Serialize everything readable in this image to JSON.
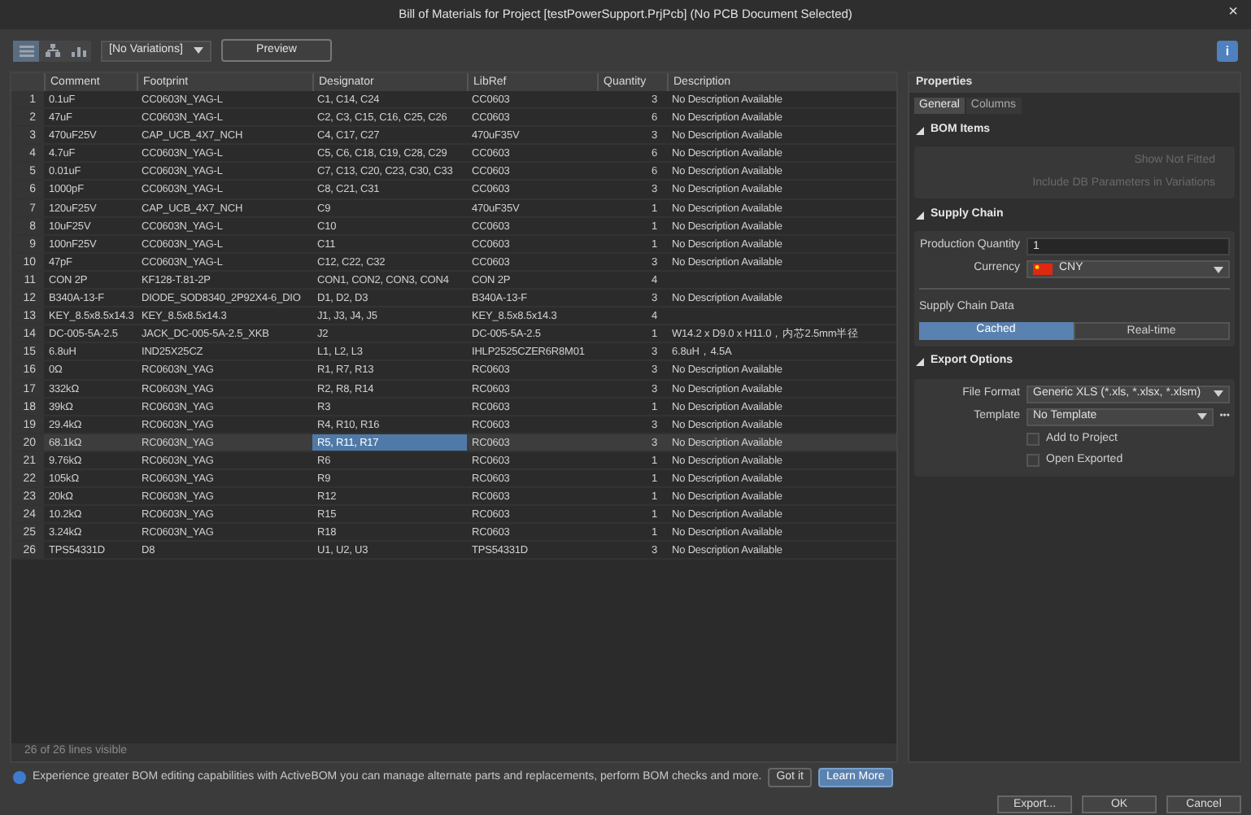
{
  "window": {
    "title": "Bill of Materials for Project [testPowerSupport.PrjPcb] (No PCB Document Selected)",
    "close": "×"
  },
  "toolbar": {
    "views": [
      {
        "kind": "table",
        "selected": true
      },
      {
        "kind": "tree",
        "selected": false
      },
      {
        "kind": "chart",
        "selected": false
      }
    ],
    "variations": "[No Variations]",
    "preview": "Preview",
    "info": "i"
  },
  "table": {
    "columns": [
      "Comment",
      "Footprint",
      "Designator",
      "LibRef",
      "Quantity",
      "Description"
    ],
    "rows": [
      {
        "no": "1",
        "comment": "0.1uF",
        "footprint": "CC0603N_YAG-L",
        "designator": "C1, C14, C24",
        "libref": "CC0603",
        "quantity": "3",
        "description": "No Description Available",
        "selected": false
      },
      {
        "no": "2",
        "comment": "47uF",
        "footprint": "CC0603N_YAG-L",
        "designator": "C2, C3, C15, C16, C25, C26",
        "libref": "CC0603",
        "quantity": "6",
        "description": "No Description Available",
        "selected": false
      },
      {
        "no": "3",
        "comment": "470uF25V",
        "footprint": "CAP_UCB_4X7_NCH",
        "designator": "C4, C17, C27",
        "libref": "470uF35V",
        "quantity": "3",
        "description": "No Description Available",
        "selected": false
      },
      {
        "no": "4",
        "comment": "4.7uF",
        "footprint": "CC0603N_YAG-L",
        "designator": "C5, C6, C18, C19, C28, C29",
        "libref": "CC0603",
        "quantity": "6",
        "description": "No Description Available",
        "selected": false
      },
      {
        "no": "5",
        "comment": "0.01uF",
        "footprint": "CC0603N_YAG-L",
        "designator": "C7, C13, C20, C23, C30, C33",
        "libref": "CC0603",
        "quantity": "6",
        "description": "No Description Available",
        "selected": false
      },
      {
        "no": "6",
        "comment": "1000pF",
        "footprint": "CC0603N_YAG-L",
        "designator": "C8, C21, C31",
        "libref": "CC0603",
        "quantity": "3",
        "description": "No Description Available",
        "selected": false
      },
      {
        "no": "7",
        "comment": "120uF25V",
        "footprint": "CAP_UCB_4X7_NCH",
        "designator": "C9",
        "libref": "470uF35V",
        "quantity": "1",
        "description": "No Description Available",
        "selected": false
      },
      {
        "no": "8",
        "comment": "10uF25V",
        "footprint": "CC0603N_YAG-L",
        "designator": "C10",
        "libref": "CC0603",
        "quantity": "1",
        "description": "No Description Available",
        "selected": false
      },
      {
        "no": "9",
        "comment": "100nF25V",
        "footprint": "CC0603N_YAG-L",
        "designator": "C11",
        "libref": "CC0603",
        "quantity": "1",
        "description": "No Description Available",
        "selected": false
      },
      {
        "no": "10",
        "comment": "47pF",
        "footprint": "CC0603N_YAG-L",
        "designator": "C12, C22, C32",
        "libref": "CC0603",
        "quantity": "3",
        "description": "No Description Available",
        "selected": false
      },
      {
        "no": "11",
        "comment": "CON 2P",
        "footprint": "KF128-T.81-2P",
        "designator": "CON1, CON2, CON3, CON4",
        "libref": "CON 2P",
        "quantity": "4",
        "selected": false
      },
      {
        "no": "12",
        "comment": "B340A-13-F",
        "footprint": "DIODE_SOD8340_2P92X4-6_DIO",
        "designator": "D1, D2, D3",
        "libref": "B340A-13-F",
        "quantity": "3",
        "description": "No Description Available",
        "selected": false
      },
      {
        "no": "13",
        "comment": "KEY_8.5x8.5x14.3",
        "footprint": "KEY_8.5x8.5x14.3",
        "designator": "J1, J3, J4, J5",
        "libref": "KEY_8.5x8.5x14.3",
        "quantity": "4",
        "selected": false
      },
      {
        "no": "14",
        "comment": "DC-005-5A-2.5",
        "footprint": "JACK_DC-005-5A-2.5_XKB",
        "designator": "J2",
        "libref": "DC-005-5A-2.5",
        "quantity": "1",
        "description": "W14.2 x D9.0 x H11.0，内芯2.5mm半径",
        "selected": false
      },
      {
        "no": "15",
        "comment": "6.8uH",
        "footprint": "IND25X25CZ",
        "designator": "L1, L2, L3",
        "libref": "IHLP2525CZER6R8M01",
        "quantity": "3",
        "description": "6.8uH，4.5A",
        "selected": false
      },
      {
        "no": "16",
        "comment": "0Ω",
        "footprint": "RC0603N_YAG",
        "designator": "R1, R7, R13",
        "libref": "RC0603",
        "quantity": "3",
        "description": "No Description Available",
        "selected": false
      },
      {
        "no": "17",
        "comment": "332kΩ",
        "footprint": "RC0603N_YAG",
        "designator": "R2, R8, R14",
        "libref": "RC0603",
        "quantity": "3",
        "description": "No Description Available",
        "selected": false
      },
      {
        "no": "18",
        "comment": "39kΩ",
        "footprint": "RC0603N_YAG",
        "designator": "R3",
        "libref": "RC0603",
        "quantity": "1",
        "description": "No Description Available",
        "selected": false
      },
      {
        "no": "19",
        "comment": "29.4kΩ",
        "footprint": "RC0603N_YAG",
        "designator": "R4, R10, R16",
        "libref": "RC0603",
        "quantity": "3",
        "description": "No Description Available",
        "selected": false
      },
      {
        "no": "20",
        "comment": "68.1kΩ",
        "footprint": "RC0603N_YAG",
        "designator": "R5, R11, R17",
        "libref": "RC0603",
        "quantity": "3",
        "description": "No Description Available",
        "selected": true
      },
      {
        "no": "21",
        "comment": "9.76kΩ",
        "footprint": "RC0603N_YAG",
        "designator": "R6",
        "libref": "RC0603",
        "quantity": "1",
        "description": "No Description Available",
        "selected": false
      },
      {
        "no": "22",
        "comment": "105kΩ",
        "footprint": "RC0603N_YAG",
        "designator": "R9",
        "libref": "RC0603",
        "quantity": "1",
        "description": "No Description Available",
        "selected": false
      },
      {
        "no": "23",
        "comment": "20kΩ",
        "footprint": "RC0603N_YAG",
        "designator": "R12",
        "libref": "RC0603",
        "quantity": "1",
        "description": "No Description Available",
        "selected": false
      },
      {
        "no": "24",
        "comment": "10.2kΩ",
        "footprint": "RC0603N_YAG",
        "designator": "R15",
        "libref": "RC0603",
        "quantity": "1",
        "description": "No Description Available",
        "selected": false
      },
      {
        "no": "25",
        "comment": "3.24kΩ",
        "footprint": "RC0603N_YAG",
        "designator": "R18",
        "libref": "RC0603",
        "quantity": "1",
        "description": "No Description Available",
        "selected": false
      },
      {
        "no": "26",
        "comment": "TPS54331D",
        "footprint": "D8",
        "designator": "U1, U2, U3",
        "libref": "TPS54331D",
        "quantity": "3",
        "description": "No Description Available",
        "selected": false
      }
    ],
    "status": "26 of 26 lines visible"
  },
  "properties": {
    "title": "Properties",
    "tabs": [
      {
        "label": "General",
        "selected": true
      },
      {
        "label": "Columns",
        "selected": false
      }
    ],
    "bom_items": {
      "title": "BOM Items",
      "expanded": true,
      "options": [
        {
          "label": "Show Not Fitted",
          "disabled": true
        },
        {
          "label": "Include DB Parameters in Variations",
          "disabled": true
        }
      ]
    },
    "supply_chain": {
      "title": "Supply Chain",
      "expanded": true,
      "production_quantity_label": "Production Quantity",
      "production_quantity": "1",
      "currency_label": "Currency",
      "currency": "CNY",
      "data_label": "Supply Chain Data",
      "data_options": [
        {
          "label": "Cached",
          "selected": true
        },
        {
          "label": "Real-time",
          "selected": false
        }
      ]
    },
    "export_options": {
      "title": "Export Options",
      "expanded": true,
      "file_format_label": "File Format",
      "file_format": "Generic XLS (*.xls, *.xlsx, *.xlsm)",
      "template_label": "Template",
      "template": "No Template",
      "template_more": "•••",
      "checks": [
        {
          "label": "Add to Project",
          "checked": false
        },
        {
          "label": "Open Exported",
          "checked": false
        }
      ]
    }
  },
  "notice": {
    "text": "Experience greater BOM editing capabilities with ActiveBOM you can manage alternate parts and replacements, perform BOM checks and more.",
    "buttons": [
      {
        "label": "Got it",
        "primary": false
      },
      {
        "label": "Learn More",
        "primary": true
      }
    ]
  },
  "footer_buttons": [
    "Export...",
    "OK",
    "Cancel"
  ]
}
